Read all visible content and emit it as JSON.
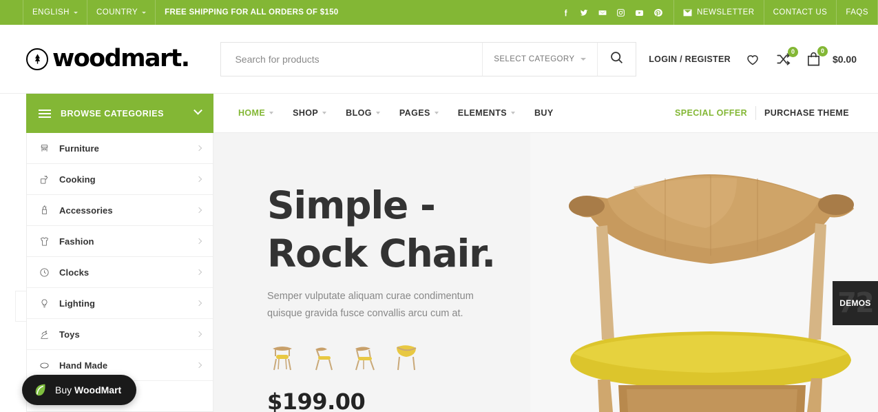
{
  "topbar": {
    "language": {
      "label": "ENGLISH",
      "icon": "chevron-down-icon"
    },
    "country": {
      "label": "COUNTRY",
      "icon": "chevron-down-icon"
    },
    "promo": "FREE SHIPPING FOR ALL ORDERS OF $150",
    "socials": [
      {
        "name": "facebook-icon",
        "label": "Facebook"
      },
      {
        "name": "twitter-icon",
        "label": "Twitter"
      },
      {
        "name": "email-icon",
        "label": "Email"
      },
      {
        "name": "instagram-icon",
        "label": "Instagram"
      },
      {
        "name": "youtube-icon",
        "label": "YouTube"
      },
      {
        "name": "pinterest-icon",
        "label": "Pinterest"
      }
    ],
    "newsletter": "NEWSLETTER",
    "contact": "CONTACT US",
    "faqs": "FAQS",
    "bg_color": "#83b735"
  },
  "header": {
    "logo_text": "woodmart.",
    "logo_icon": "tree-circle-icon",
    "search": {
      "placeholder": "Search for products",
      "value": "",
      "category_label": "SELECT CATEGORY",
      "submit_icon": "search-icon"
    },
    "login_label": "LOGIN / REGISTER",
    "wishlist_icon": "heart-icon",
    "compare_icon": "compare-icon",
    "compare_count": "0",
    "cart_icon": "shopping-bag-icon",
    "cart_count": "0",
    "cart_total": "$0.00"
  },
  "nav": {
    "browse_label": "BROWSE CATEGORIES",
    "browse_icon": "hamburger-icon",
    "browse_caret": "chevron-down-icon",
    "items": [
      {
        "label": "HOME",
        "has_caret": true,
        "active": true
      },
      {
        "label": "SHOP",
        "has_caret": true,
        "active": false
      },
      {
        "label": "BLOG",
        "has_caret": true,
        "active": false
      },
      {
        "label": "PAGES",
        "has_caret": true,
        "active": false
      },
      {
        "label": "ELEMENTS",
        "has_caret": true,
        "active": false
      },
      {
        "label": "BUY",
        "has_caret": false,
        "active": false
      }
    ],
    "special_offer": "SPECIAL OFFER",
    "purchase_theme": "PURCHASE THEME",
    "accent_color": "#83b735"
  },
  "sidebar": {
    "categories": [
      {
        "label": "Furniture",
        "icon": "furniture-icon"
      },
      {
        "label": "Cooking",
        "icon": "cooking-icon"
      },
      {
        "label": "Accessories",
        "icon": "accessories-icon"
      },
      {
        "label": "Fashion",
        "icon": "fashion-icon"
      },
      {
        "label": "Clocks",
        "icon": "clock-icon"
      },
      {
        "label": "Lighting",
        "icon": "lighting-icon"
      },
      {
        "label": "Toys",
        "icon": "toys-icon"
      },
      {
        "label": "Hand Made",
        "icon": "handmade-icon"
      }
    ]
  },
  "hero": {
    "title": "Simple -\nRock Chair.",
    "subtitle": "Semper vulputate aliquam curae condimentum quisque gravida fusce convallis arcu cum at.",
    "price": "$199.00",
    "thumbnails": [
      {
        "name": "chair-thumb-front"
      },
      {
        "name": "chair-thumb-side"
      },
      {
        "name": "chair-thumb-angle"
      },
      {
        "name": "chair-thumb-top"
      }
    ],
    "product_image": "rocking-chair-photo",
    "bg_color": "#f4f4f4"
  },
  "demos_tab": {
    "label": "DEMOS",
    "count": "72"
  },
  "buy_button": {
    "prefix": "Buy ",
    "brand": "WoodMart",
    "icon": "leaf-icon"
  }
}
